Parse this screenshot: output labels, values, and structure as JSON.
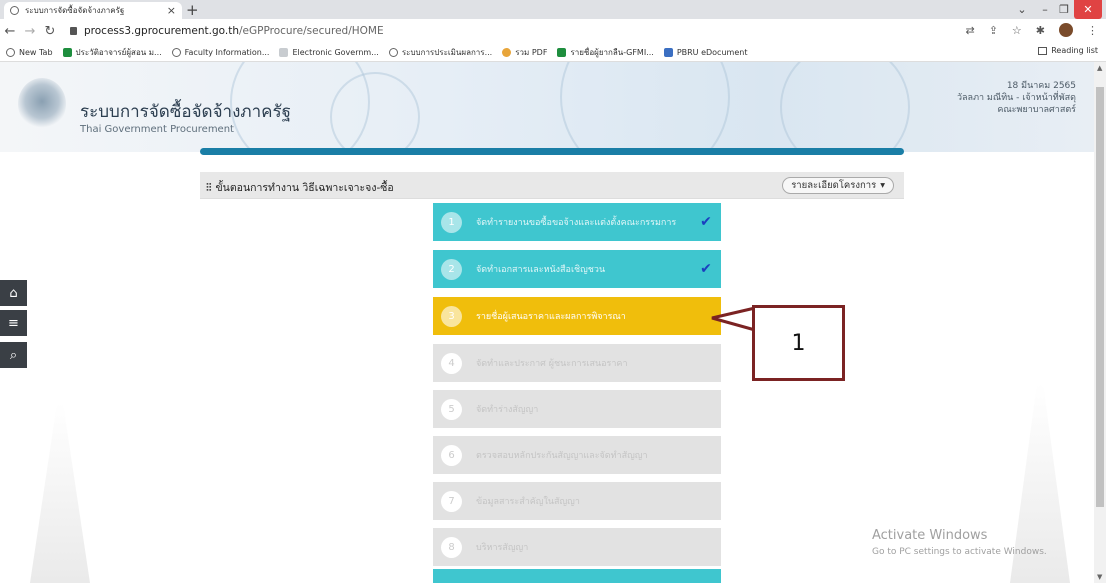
{
  "browser": {
    "tab_title": "ระบบการจัดซื้อจัดจ้างภาครัฐ",
    "new_tab": "+",
    "close_tab": "×",
    "url_domain": "process3.gprocurement.go.th",
    "url_path": "/eGPProcure/secured/HOME",
    "window_minimize": "–",
    "window_restore": "❐",
    "window_close": "✕",
    "tab_menu": "⌄"
  },
  "bookmarks": [
    {
      "label": "New Tab",
      "color": "#777777"
    },
    {
      "label": "ประวัติอาจารย์ผู้สอน ม...",
      "color": "#1e8e3e"
    },
    {
      "label": "Faculty Information...",
      "color": "#777777"
    },
    {
      "label": "Electronic Governm...",
      "color": "#9aa0a6"
    },
    {
      "label": "ระบบการประเมินผลการ...",
      "color": "#777777"
    },
    {
      "label": "รวม PDF",
      "color": "#e8a53a"
    },
    {
      "label": "รายชื่อผู้ยากลืน-GFMI...",
      "color": "#1e8e3e"
    },
    {
      "label": "PBRU eDocument",
      "color": "#3b6fc2"
    }
  ],
  "reading_list": "Reading list",
  "header": {
    "title": "ระบบการจัดซื้อจัดจ้างภาครัฐ",
    "subtitle": "Thai Government Procurement",
    "date": "18 มีนาคม 2565",
    "user": "วัลลภา มณีทิน - เจ้าหน้าที่พัสดุ",
    "faculty": "คณะพยาบาลศาสตร์"
  },
  "sidebar": {
    "home_icon": "⌂",
    "menu_icon": "≡",
    "search_icon": "⌕"
  },
  "panel": {
    "title": "ขั้นตอนการทำงาน วิธีเฉพาะเจาะจง-ซื้อ",
    "project_button": "รายละเอียดโครงการ"
  },
  "steps": [
    {
      "num": "1",
      "label": "จัดทำรายงานขอซื้อขอจ้างและแต่งตั้งคณะกรรมการ",
      "status": "done"
    },
    {
      "num": "2",
      "label": "จัดทำเอกสารและหนังสือเชิญชวน",
      "status": "done"
    },
    {
      "num": "3",
      "label": "รายชื่อผู้เสนอราคาและผลการพิจารณา",
      "status": "active"
    },
    {
      "num": "4",
      "label": "จัดทำและประกาศ ผู้ชนะการเสนอราคา",
      "status": "pending"
    },
    {
      "num": "5",
      "label": "จัดทำร่างสัญญา",
      "status": "pending"
    },
    {
      "num": "6",
      "label": "ตรวจสอบหลักประกันสัญญาและจัดทำสัญญา",
      "status": "pending"
    },
    {
      "num": "7",
      "label": "ข้อมูลสาระสำคัญในสัญญา",
      "status": "pending"
    },
    {
      "num": "8",
      "label": "บริหารสัญญา",
      "status": "pending"
    }
  ],
  "callout": "1",
  "watermark": {
    "line1": "Activate Windows",
    "line2": "Go to PC settings to activate Windows."
  }
}
